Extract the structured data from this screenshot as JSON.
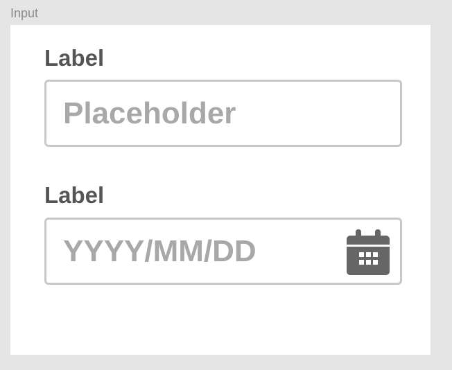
{
  "frame": {
    "title": "Input"
  },
  "fields": [
    {
      "label": "Label",
      "placeholder": "Placeholder"
    },
    {
      "label": "Label",
      "placeholder": "YYYY/MM/DD",
      "icon": "calendar-icon"
    }
  ],
  "colors": {
    "background": "#e5e5e5",
    "frame": "#ffffff",
    "label": "#555555",
    "placeholder": "#a8a8a8",
    "border": "#c8c8c8",
    "icon": "#666666"
  }
}
